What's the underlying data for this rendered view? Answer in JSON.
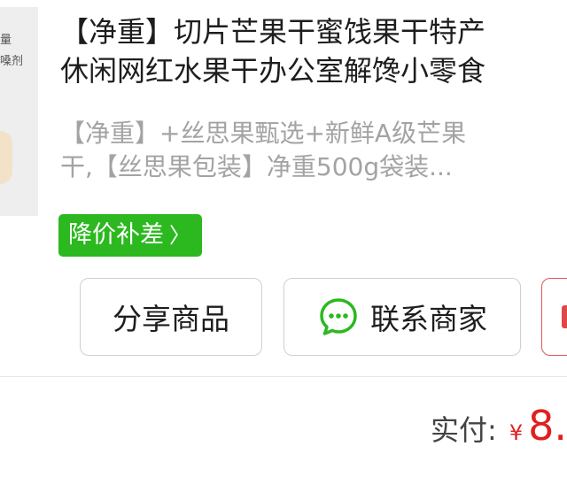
{
  "product": {
    "thumbnail_text": "量\n嗓剂",
    "title_lines": [
      "【净重】切片芒果干蜜饯果干特产",
      "休闲网红水果干办公室解馋小零食"
    ],
    "spec_lines": [
      "【净重】+丝思果甄选+新鲜A级芒果",
      "干,【丝思果包装】净重500g袋装..."
    ],
    "badge_label": "降价补差",
    "badge_chevron": "〉"
  },
  "actions": {
    "share_label": "分享商品",
    "contact_label": "联系商家",
    "chat_icon": "chat-bubble-icon"
  },
  "payment": {
    "label": "实付:",
    "currency": "¥",
    "amount": "8."
  },
  "colors": {
    "badge_green": "#2cb81f",
    "price_red": "#e02020",
    "chat_green": "#2cb81f"
  }
}
